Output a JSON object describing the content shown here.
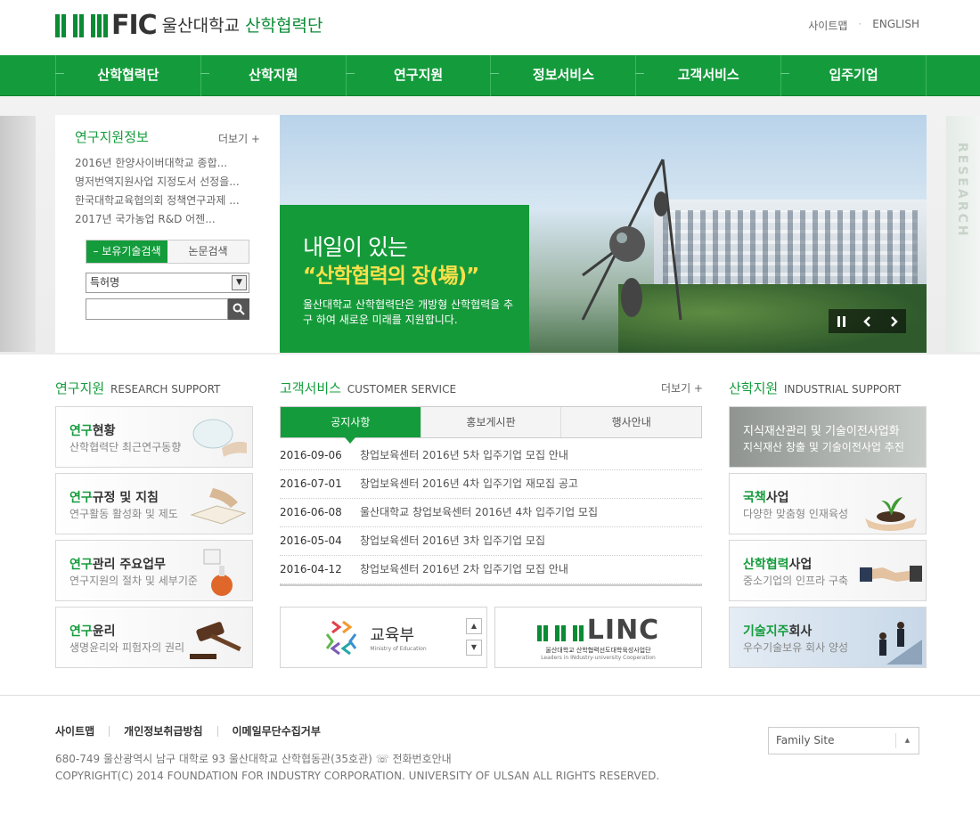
{
  "header": {
    "logo_fic": "FIC",
    "logo_univ": "울산대학교",
    "logo_dept": "산학협력단",
    "util": [
      "사이트맵",
      "ENGLISH"
    ]
  },
  "nav": [
    "산학협력단",
    "산학지원",
    "연구지원",
    "정보서비스",
    "고객서비스",
    "입주기업"
  ],
  "side_text": "RESEARCH",
  "research_info": {
    "title": "연구지원정보",
    "more": "더보기 +",
    "items": [
      "2016년 한양사이버대학교 종합...",
      "명저번역지원사업 지정도서 선정을...",
      "한국대학교육협의회 정책연구과제 ...",
      "2017년 국가농업 R&D 어젠..."
    ],
    "tabs": [
      "보유기술검색",
      "논문검색"
    ],
    "select_value": "특허명"
  },
  "banner": {
    "line1": "내일이 있는",
    "line2": "“산학협력의 장(場)”",
    "desc": "울산대학교 산학협력단은 개방형 산학협력을 추구 하여 새로운 미래를 지원합니다."
  },
  "research_support": {
    "title": "연구지원",
    "title_en": "RESEARCH SUPPORT",
    "cards": [
      {
        "bold": "연구",
        "rest": "현황",
        "sub": "산학협력단 최근연구동향"
      },
      {
        "bold": "연구",
        "rest": "규정 및 지침",
        "sub": "연구활동 활성화 및 제도"
      },
      {
        "bold": "연구",
        "rest": "관리 주요업무",
        "sub": "연구지원의 절차 및 세부기준"
      },
      {
        "bold": "연구",
        "rest": "윤리",
        "sub": "생명윤리와 피험자의 권리"
      }
    ]
  },
  "customer_service": {
    "title": "고객서비스",
    "title_en": "CUSTOMER SERVICE",
    "more": "더보기 +",
    "tabs": [
      "공지사항",
      "홍보게시판",
      "행사안내"
    ],
    "notices": [
      {
        "date": "2016-09-06",
        "text": "창업보육센터 2016년 5차 입주기업 모집 안내"
      },
      {
        "date": "2016-07-01",
        "text": "창업보육센터 2016년 4차 입주기업 재모집 공고"
      },
      {
        "date": "2016-06-08",
        "text": "울산대학교 창업보육센터 2016년 4차 입주기업 모집"
      },
      {
        "date": "2016-05-04",
        "text": "창업보육센터 2016년 3차 입주기업 모집"
      },
      {
        "date": "2016-04-12",
        "text": "창업보육센터 2016년 2차 입주기업 모집 안내"
      }
    ],
    "moe_name": "교육부",
    "moe_en": "Ministry of Education",
    "linc_name": "LINC",
    "linc_sub": "울산대학교 산학협력선도대학육성사업단",
    "linc_en": "Leaders in INdustry-university Cooperation"
  },
  "industrial_support": {
    "title": "산학지원",
    "title_en": "INDUSTRIAL SUPPORT",
    "cards": [
      {
        "bold": "",
        "rest": "지식재산관리 및 기술이전사업화",
        "sub": "지식재산 창출 및 기술이전사업 추진"
      },
      {
        "bold": "국책",
        "rest": "사업",
        "sub": "다양한 맞춤형 인재육성"
      },
      {
        "bold": "산학협력",
        "rest": "사업",
        "sub": "중소기업의 인프라 구축"
      },
      {
        "bold": "기술지주",
        "rest": "회사",
        "sub": "우수기술보유 회사 양성"
      }
    ]
  },
  "footer": {
    "links": [
      "사이트맵",
      "개인정보취급방침",
      "이메일무단수집거부"
    ],
    "address": "680-749 울산광역시 남구 대학로 93 울산대학교 산학협동관(35호관) ☏ 전화번호안내",
    "copyright": "COPYRIGHT(C) 2014 FOUNDATION FOR INDUSTRY CORPORATION. UNIVERSITY OF ULSAN ALL RIGHTS RESERVED.",
    "family_site": "Family Site"
  },
  "colors": {
    "brand": "#149c3c",
    "accent_yellow": "#f7e04a",
    "logo_red": "#e02020"
  }
}
